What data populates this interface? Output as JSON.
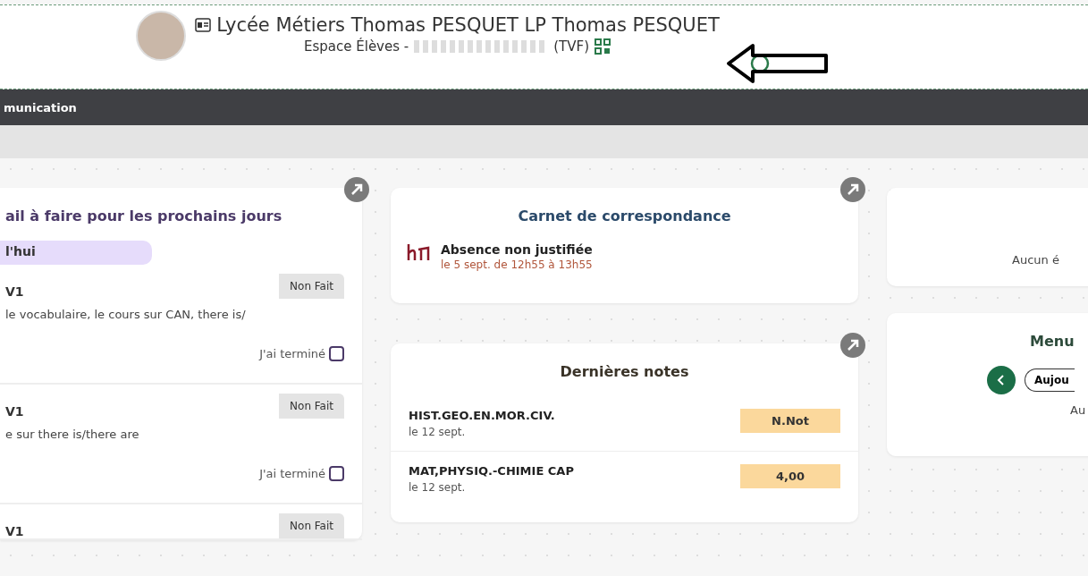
{
  "header": {
    "title": "Lycée Métiers Thomas PESQUET LP Thomas PESQUET",
    "subtitle_prefix": "Espace Élèves -",
    "subtitle_suffix": "(TVF)",
    "name_redacted": true
  },
  "nav": {
    "items": [
      "munication"
    ]
  },
  "homework": {
    "title": "ail à faire pour les prochains jours",
    "day": "l'hui",
    "items": [
      {
        "subject": "V1",
        "status": "Non Fait",
        "text": "le vocabulaire, le cours sur CAN, there is/",
        "done_label": "J'ai terminé",
        "checked": false
      },
      {
        "subject": "V1",
        "status": "Non Fait",
        "text": "e sur there is/there are",
        "done_label": "J'ai terminé",
        "checked": false
      },
      {
        "subject": "V1",
        "status": "Non Fait"
      }
    ]
  },
  "correspondence": {
    "title": "Carnet de correspondance",
    "entries": [
      {
        "label": "Absence non justifiée",
        "when": "le 5 sept. de 12h55 à 13h55"
      }
    ]
  },
  "grades": {
    "title": "Dernières notes",
    "rows": [
      {
        "subject": "HIST.GEO.EN.MOR.CIV.",
        "date": "le 12 sept.",
        "grade": "N.Not"
      },
      {
        "subject": "MAT,PHYSIQ.-CHIMIE CAP",
        "date": "le 12 sept.",
        "grade": "4,00"
      }
    ]
  },
  "events": {
    "text": "Aucun é"
  },
  "menu": {
    "title": "Menu",
    "day_button": "Aujou",
    "text": "Au"
  }
}
